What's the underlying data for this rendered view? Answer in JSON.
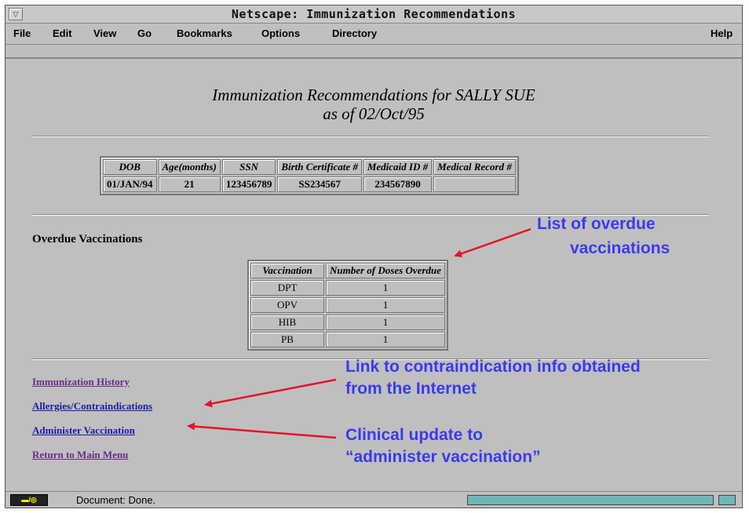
{
  "window": {
    "title": "Netscape: Immunization Recommendations"
  },
  "menubar": {
    "items": [
      "File",
      "Edit",
      "View",
      "Go",
      "Bookmarks",
      "Options",
      "Directory"
    ],
    "help": "Help"
  },
  "page": {
    "heading_line1": "Immunization Recommendations for SALLY SUE",
    "heading_line2": "as of 02/Oct/95",
    "patient_table": {
      "headers": [
        "DOB",
        "Age(months)",
        "SSN",
        "Birth Certificate #",
        "Medicaid ID #",
        "Medical Record #"
      ],
      "row": [
        "01/JAN/94",
        "21",
        "123456789",
        "SS234567",
        "234567890",
        ""
      ]
    },
    "overdue_title": "Overdue Vaccinations",
    "overdue_table": {
      "headers": [
        "Vaccination",
        "Number of Doses Overdue"
      ],
      "rows": [
        [
          "DPT",
          "1"
        ],
        [
          "OPV",
          "1"
        ],
        [
          "HIB",
          "1"
        ],
        [
          "PB",
          "1"
        ]
      ]
    },
    "links": [
      "Immunization History",
      "Allergies/Contraindications",
      "Administer Vaccination",
      "Return to Main Menu"
    ]
  },
  "annotations": {
    "overdue_line1": "List of overdue",
    "overdue_line2": "vaccinations",
    "contra_line1": "Link to contraindication info obtained",
    "contra_line2": "from the Internet",
    "clinical_line1": "Clinical update to",
    "clinical_line2": "“administer vaccination”"
  },
  "status": {
    "text": "Document: Done.",
    "progress": 1.0
  },
  "colors": {
    "annotation": "#3a3aee",
    "arrow": "#e8102a",
    "link_visited": "#6a2a8a",
    "link_unvisited": "#1a1aa8",
    "progress": "#6fb7b7"
  }
}
